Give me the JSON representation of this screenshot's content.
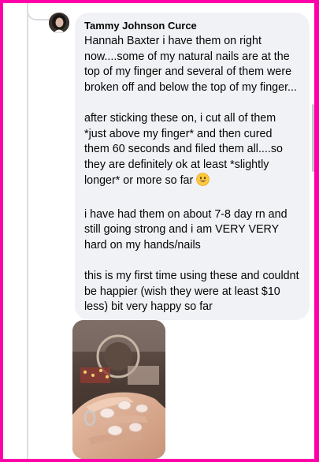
{
  "comment": {
    "author": "Tammy Johnson Curce",
    "paragraphs": [
      "Hannah Baxter i have them on right now....some of my natural nails are at the top of my finger and several of them were broken off and below the top of my finger...",
      "after sticking these on, i cut all of them *just above my finger* and then cured them 60 seconds and filed them all....so they are definitely ok at least *slightly longer* or more so far",
      "i have had them on about 7-8 day rn and still going strong and i am VERY VERY hard on my hands/nails",
      "this is my first time using these and couldnt be happier (wish they were at least $10 less) bit very happy so far"
    ],
    "emoji": "grinning-face-emoji",
    "avatar_icon": "profile-photo",
    "attachment_icon": "nail-photo"
  },
  "colors": {
    "border": "#ff00a8",
    "bubble": "#f0f2f5",
    "text": "#050505",
    "thread_line": "#dadde1"
  }
}
